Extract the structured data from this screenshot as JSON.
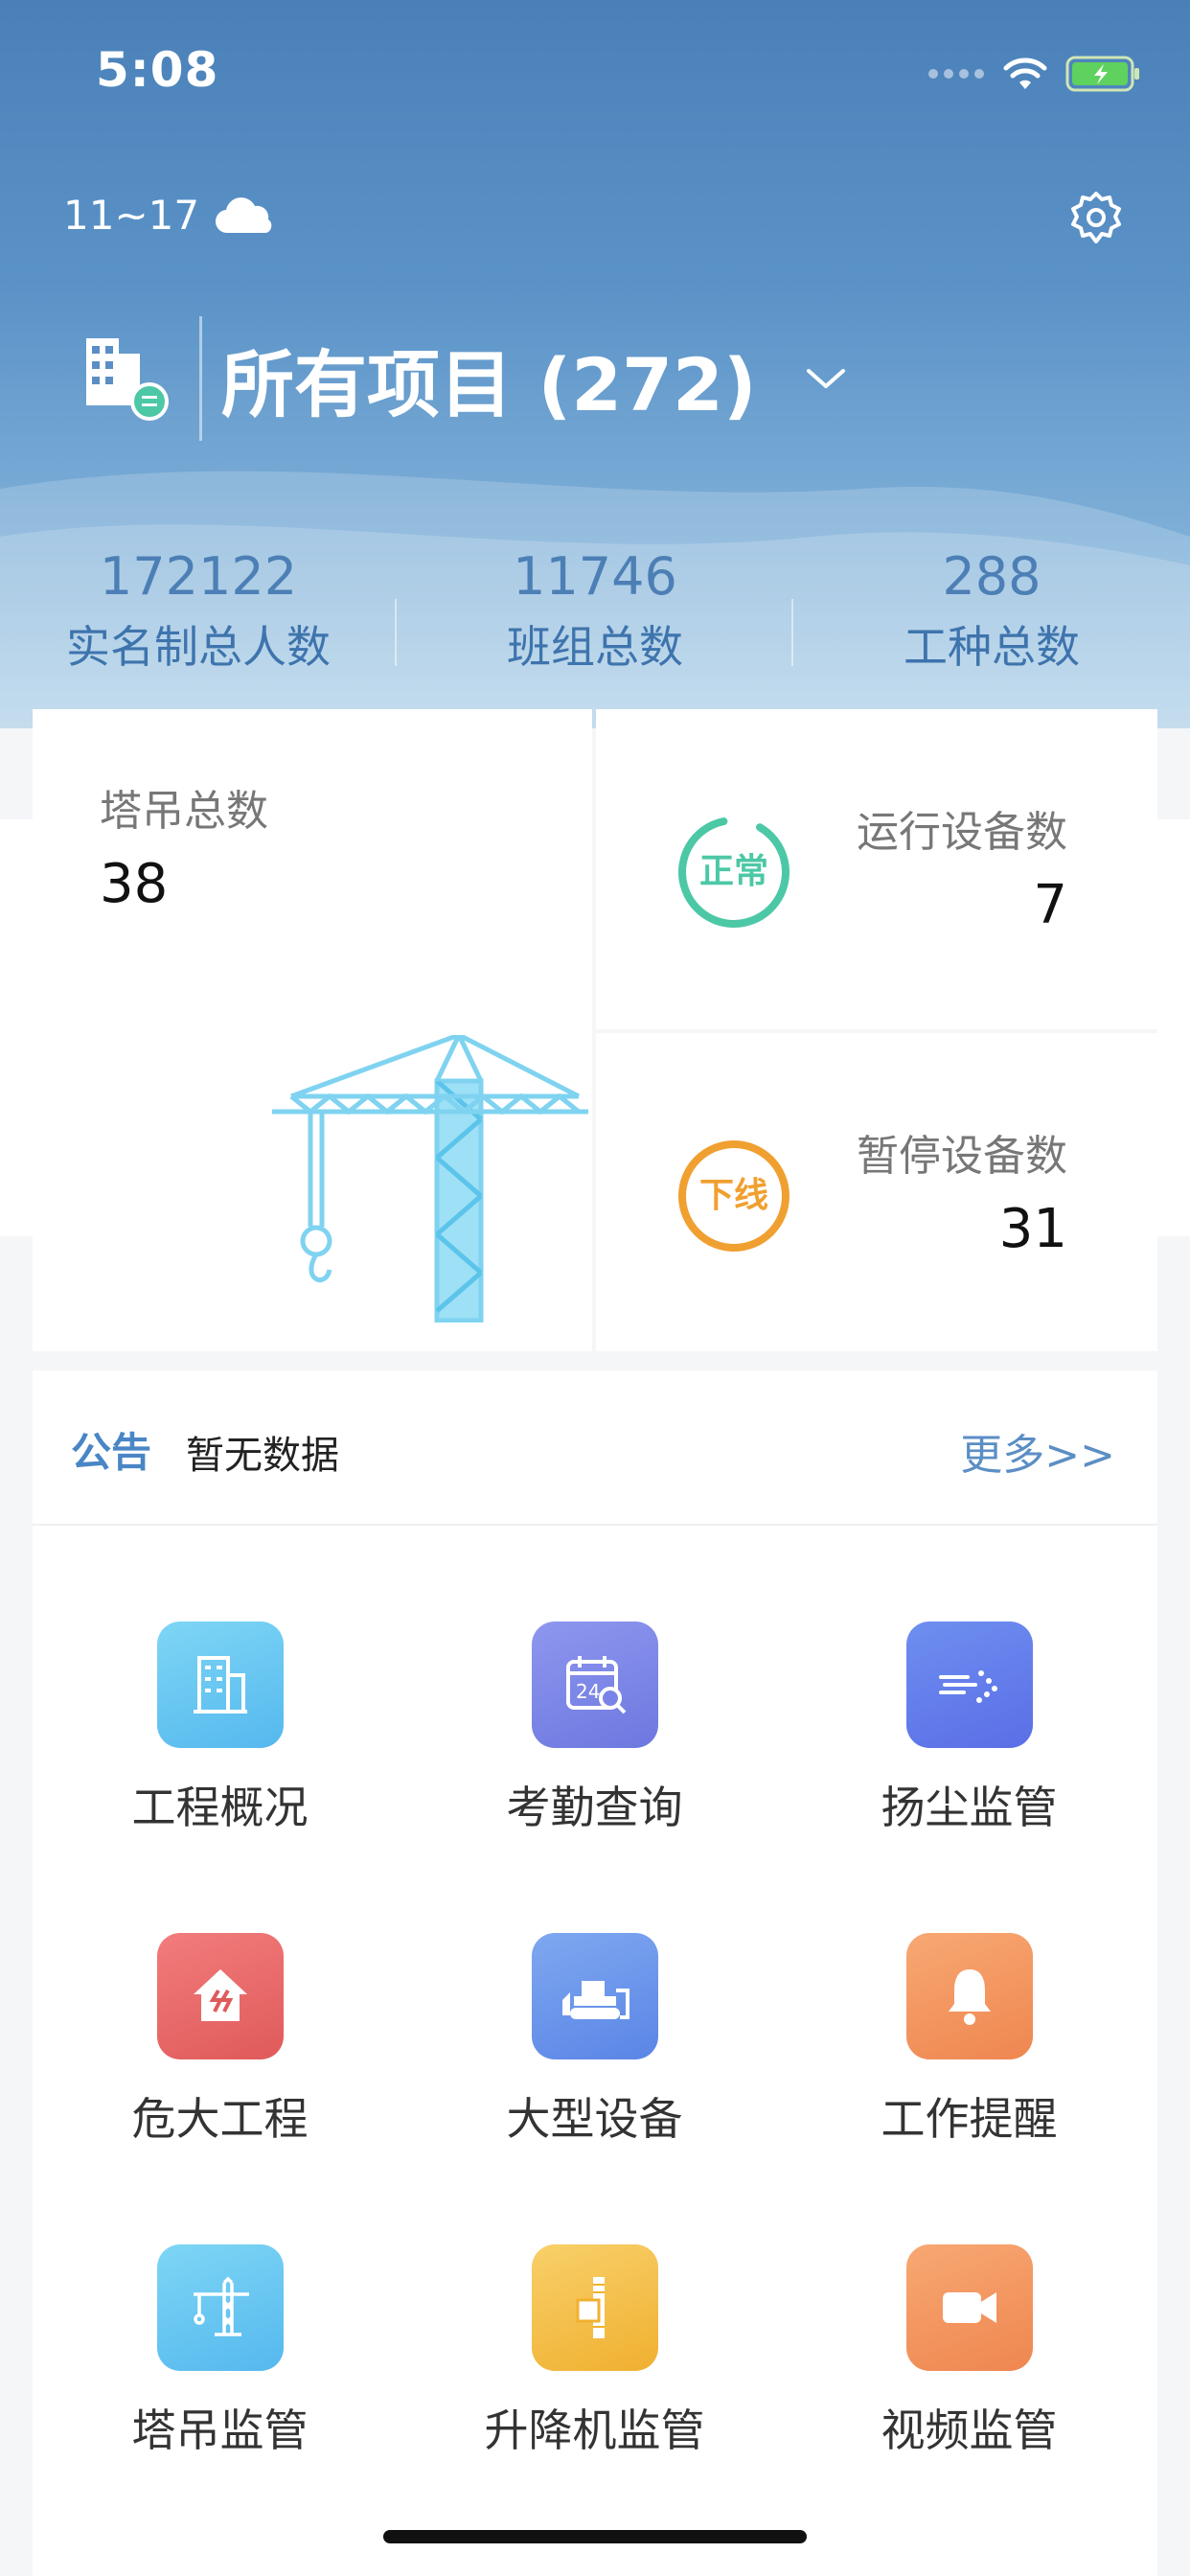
{
  "status_bar": {
    "time": "5:08"
  },
  "weather": {
    "temp_range": "11~17",
    "icon": "cloud-icon"
  },
  "project": {
    "title": "所有项目 (272)"
  },
  "stats": [
    {
      "value": "172122",
      "label": "实名制总人数"
    },
    {
      "value": "11746",
      "label": "班组总数"
    },
    {
      "value": "288",
      "label": "工种总数"
    }
  ],
  "crane": {
    "label": "塔吊总数",
    "value": "38"
  },
  "devices": {
    "running": {
      "status": "正常",
      "label": "运行设备数",
      "value": "7",
      "color": "#4cc8a6"
    },
    "paused": {
      "status": "下线",
      "label": "暂停设备数",
      "value": "31",
      "color": "#f0a030"
    }
  },
  "notice": {
    "tag": "公告",
    "text": "暂无数据",
    "more": "更多>>"
  },
  "menu": [
    {
      "label": "工程概况",
      "icon": "building-icon",
      "color_from": "#7ed6f5",
      "color_to": "#55b8ee"
    },
    {
      "label": "考勤查询",
      "icon": "calendar-search-icon",
      "color_from": "#8e97ee",
      "color_to": "#6d78e0"
    },
    {
      "label": "扬尘监管",
      "icon": "dust-icon",
      "color_from": "#6e8ff0",
      "color_to": "#5a6ee6"
    },
    {
      "label": "危大工程",
      "icon": "danger-house-icon",
      "color_from": "#f27c7c",
      "color_to": "#e05a5a"
    },
    {
      "label": "大型设备",
      "icon": "bulldozer-icon",
      "color_from": "#7fa8f0",
      "color_to": "#5a85e6"
    },
    {
      "label": "工作提醒",
      "icon": "bell-icon",
      "color_from": "#f8a873",
      "color_to": "#ef8650"
    },
    {
      "label": "塔吊监管",
      "icon": "tower-crane-icon",
      "color_from": "#7ed6f5",
      "color_to": "#55b8ee"
    },
    {
      "label": "升降机监管",
      "icon": "elevator-icon",
      "color_from": "#f8d06a",
      "color_to": "#f0b030"
    },
    {
      "label": "视频监管",
      "icon": "video-icon",
      "color_from": "#f8a873",
      "color_to": "#ef8650"
    }
  ]
}
